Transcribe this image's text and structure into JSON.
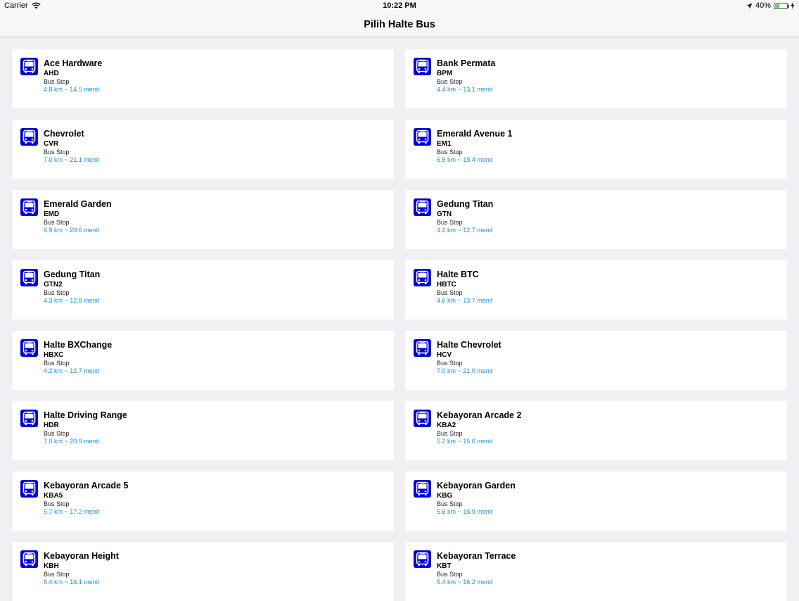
{
  "status_bar": {
    "carrier": "Carrier",
    "time": "10:22 PM",
    "battery": "40%",
    "battery_level": 0.4
  },
  "nav": {
    "title": "Pilih Halte Bus"
  },
  "icon_color": "#0000d4",
  "stops": [
    {
      "name": "Ace Hardware",
      "code": "AHD",
      "type": "Bus Stop",
      "distance": "4.8 km ~ 14.5 menit"
    },
    {
      "name": "Bank Permata",
      "code": "BPM",
      "type": "Bus Stop",
      "distance": "4.4 km ~ 13.1 menit"
    },
    {
      "name": "Chevrolet",
      "code": "CVR",
      "type": "Bus Stop",
      "distance": "7.0 km ~ 21.1 menit"
    },
    {
      "name": "Emerald Avenue 1",
      "code": "EM1",
      "type": "Bus Stop",
      "distance": "6.5 km ~ 19.4 menit"
    },
    {
      "name": "Emerald Garden",
      "code": "EMD",
      "type": "Bus Stop",
      "distance": "6.9 km ~ 20.6 menit"
    },
    {
      "name": "Gedung Titan",
      "code": "GTN",
      "type": "Bus Stop",
      "distance": "4.2 km ~ 12.7 menit"
    },
    {
      "name": "Gedung Titan",
      "code": "GTN2",
      "type": "Bus Stop",
      "distance": "4.3 km ~ 12.8 menit"
    },
    {
      "name": "Halte BTC",
      "code": "HBTC",
      "type": "Bus Stop",
      "distance": "4.6 km ~ 13.7 menit"
    },
    {
      "name": "Halte BXChange",
      "code": "HBXC",
      "type": "Bus Stop",
      "distance": "4.2 km ~ 12.7 menit"
    },
    {
      "name": "Halte Chevrolet",
      "code": "HCV",
      "type": "Bus Stop",
      "distance": "7.0 km ~ 21.0 menit"
    },
    {
      "name": "Halte Driving Range",
      "code": "HDR",
      "type": "Bus Stop",
      "distance": "7.0 km ~ 20.9 menit"
    },
    {
      "name": "Kebayoran Arcade 2",
      "code": "KBA2",
      "type": "Bus Stop",
      "distance": "5.2 km ~ 15.6 menit"
    },
    {
      "name": "Kebayoran Arcade 5",
      "code": "KBA5",
      "type": "Bus Stop",
      "distance": "5.7 km ~ 17.2 menit"
    },
    {
      "name": "Kebayoran Garden",
      "code": "KBG",
      "type": "Bus Stop",
      "distance": "5.6 km ~ 16.9 menit"
    },
    {
      "name": "Kebayoran Height",
      "code": "KBH",
      "type": "Bus Stop",
      "distance": "5.4 km ~ 16.1 menit"
    },
    {
      "name": "Kebayoran Terrace",
      "code": "KBT",
      "type": "Bus Stop",
      "distance": "5.4 km ~ 16.2 menit"
    }
  ]
}
